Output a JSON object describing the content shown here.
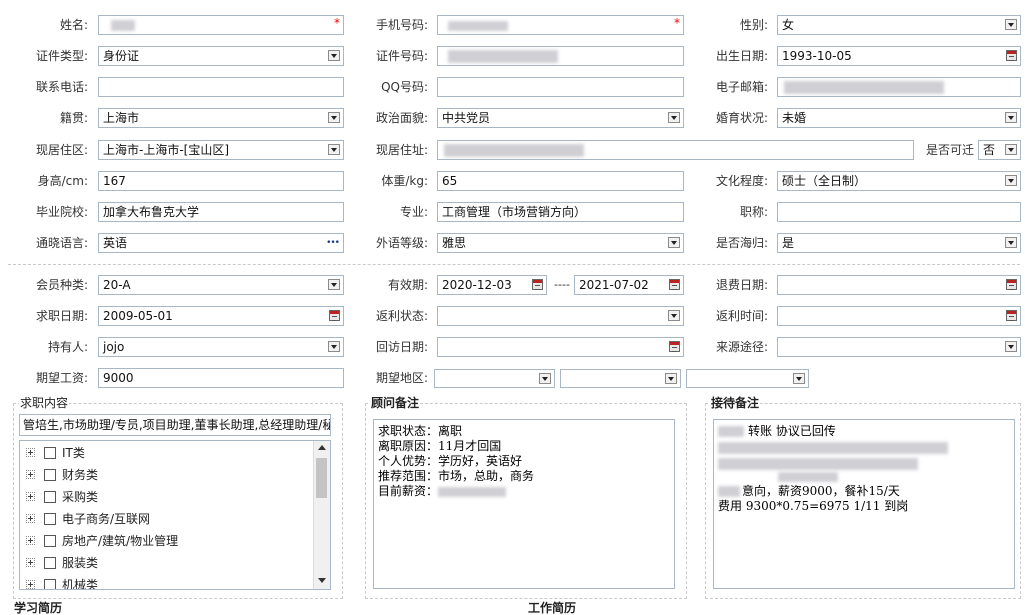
{
  "form": {
    "name": {
      "label": "姓名:"
    },
    "phone": {
      "label": "手机号码:"
    },
    "gender": {
      "label": "性别:",
      "value": "女"
    },
    "id_type": {
      "label": "证件类型:",
      "value": "身份证"
    },
    "id_no": {
      "label": "证件号码:"
    },
    "birth": {
      "label": "出生日期:",
      "value": "1993-10-05"
    },
    "tel": {
      "label": "联系电话:"
    },
    "qq": {
      "label": "QQ号码:"
    },
    "email": {
      "label": "电子邮箱:"
    },
    "native": {
      "label": "籍贯:",
      "value": "上海市"
    },
    "political": {
      "label": "政治面貌:",
      "value": "中共党员"
    },
    "marital": {
      "label": "婚育状况:",
      "value": "未婚"
    },
    "residence": {
      "label": "现居住区:",
      "value": "上海市-上海市-[宝山区]"
    },
    "address": {
      "label": "现居住址:"
    },
    "relocate": {
      "label": "是否可迁",
      "value": "否"
    },
    "height": {
      "label": "身高/cm:",
      "value": "167"
    },
    "weight": {
      "label": "体重/kg:",
      "value": "65"
    },
    "education": {
      "label": "文化程度:",
      "value": "硕士（全日制）"
    },
    "school": {
      "label": "毕业院校:",
      "value": "加拿大布鲁克大学"
    },
    "major": {
      "label": "专业:",
      "value": "工商管理（市场营销方向）"
    },
    "title": {
      "label": "职称:"
    },
    "language": {
      "label": "通晓语言:",
      "value": "英语",
      "more": "•••"
    },
    "lang_level": {
      "label": "外语等级:",
      "value": "雅思"
    },
    "returnee": {
      "label": "是否海归:",
      "value": "是"
    },
    "member_type": {
      "label": "会员种类:",
      "value": "20-A"
    },
    "valid": {
      "label": "有效期:",
      "from": "2020-12-03",
      "sep": "----",
      "to": "2021-07-02"
    },
    "refund_date": {
      "label": "退费日期:"
    },
    "apply_date": {
      "label": "求职日期:",
      "value": "2009-05-01"
    },
    "rebate_status": {
      "label": "返利状态:"
    },
    "rebate_time": {
      "label": "返利时间:"
    },
    "holder": {
      "label": "持有人:",
      "value": "jojo"
    },
    "visit_date": {
      "label": "回访日期:"
    },
    "source": {
      "label": "来源途径:"
    },
    "salary": {
      "label": "期望工资:",
      "value": "9000"
    },
    "region": {
      "label": "期望地区:"
    }
  },
  "job_panel": {
    "legend": "求职内容",
    "summary": "管培生,市场助理/专员,项目助理,董事长助理,总经理助理/秘",
    "items": [
      "IT类",
      "财务类",
      "采购类",
      "电子商务/互联网",
      "房地产/建筑/物业管理",
      "服装类",
      "机械类"
    ]
  },
  "advisor_panel": {
    "legend": "顾问备注",
    "lines": [
      {
        "k": "求职状态：",
        "v": "离职"
      },
      {
        "k": "离职原因：",
        "v": "11月才回国"
      },
      {
        "k": "个人优势：",
        "v": "学历好，英语好"
      },
      {
        "k": "推荐范围：",
        "v": "市场，总助，商务"
      },
      {
        "k": "目前薪资：",
        "v": ""
      }
    ]
  },
  "reception_panel": {
    "legend": "接待备注",
    "line1": "转账 协议已回传",
    "line2": "意向，薪资9000，餐补15/天",
    "line3": "费用 9300*0.75=6975 1/11 到岗"
  },
  "bottom": {
    "study": "学习简历",
    "work": "工作简历"
  }
}
